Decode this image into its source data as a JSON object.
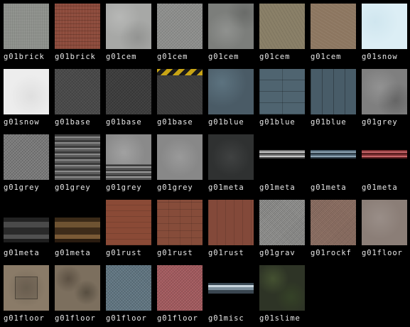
{
  "tiles": [
    {
      "label": "g01brick",
      "texture": "gbrick",
      "color": "#8e918c"
    },
    {
      "label": "g01brick",
      "texture": "rbrick",
      "color": "#8b4a3b"
    },
    {
      "label": "g01cem",
      "texture": "cem1",
      "color": "#a7a8a6"
    },
    {
      "label": "g01cem",
      "texture": "cem2",
      "color": "#8d8e8c"
    },
    {
      "label": "g01cem",
      "texture": "cem3",
      "color": "#7c7e7b"
    },
    {
      "label": "g01cem",
      "texture": "cem4",
      "color": "#8a8068"
    },
    {
      "label": "g01cem",
      "texture": "cem5",
      "color": "#8c7660"
    },
    {
      "label": "g01snow",
      "texture": "snow1",
      "color": "#dceef5"
    },
    {
      "label": "g01snow",
      "texture": "snow2",
      "color": "#ededed"
    },
    {
      "label": "g01base",
      "texture": "base1",
      "color": "#4a4a4a"
    },
    {
      "label": "g01base",
      "texture": "base2",
      "color": "#3e3e3e"
    },
    {
      "label": "g01base",
      "texture": "base3",
      "color": "#3a3a3a",
      "overlay": "hazard"
    },
    {
      "label": "g01blue",
      "texture": "blue1",
      "color": "#4a5b66"
    },
    {
      "label": "g01blue",
      "texture": "blue2",
      "color": "#4f6470"
    },
    {
      "label": "g01blue",
      "texture": "blue3",
      "color": "#485c68"
    },
    {
      "label": "g01grey",
      "texture": "grey1",
      "color": "#7f7f7f"
    },
    {
      "label": "g01grey",
      "texture": "grey2",
      "color": "#7a7a7a"
    },
    {
      "label": "g01grey",
      "texture": "grey3",
      "color": "#5c5c5c"
    },
    {
      "label": "g01grey",
      "texture": "grey4",
      "color": "#8a8a8a",
      "overlay": "grey4-stripes"
    },
    {
      "label": "g01grey",
      "texture": "grey5",
      "color": "#888888"
    },
    {
      "label": "g01meta",
      "texture": "meta1",
      "color": "#2f3131"
    },
    {
      "label": "g01meta",
      "texture": "misc",
      "color": "#000000",
      "overlay": "strip strip-grey"
    },
    {
      "label": "g01meta",
      "texture": "misc",
      "color": "#000000",
      "overlay": "strip strip-blue"
    },
    {
      "label": "g01meta",
      "texture": "misc",
      "color": "#000000",
      "overlay": "strip strip-red"
    },
    {
      "label": "g01meta",
      "texture": "misc",
      "color": "#000000",
      "overlay": "strip strip-dark"
    },
    {
      "label": "g01meta",
      "texture": "misc",
      "color": "#000000",
      "overlay": "strip strip-brown"
    },
    {
      "label": "g01rust",
      "texture": "rust1",
      "color": "#8a4a36"
    },
    {
      "label": "g01rust",
      "texture": "rust2",
      "color": "#864c3a"
    },
    {
      "label": "g01rust",
      "texture": "rust3",
      "color": "#83493a"
    },
    {
      "label": "g01grav",
      "texture": "grav",
      "color": "#8d8d8b"
    },
    {
      "label": "g01rockf",
      "texture": "rockf",
      "color": "#8c6e62"
    },
    {
      "label": "g01floor",
      "texture": "floor1",
      "color": "#8b7e77"
    },
    {
      "label": "g01floor",
      "texture": "floor2",
      "color": "#8a7b68",
      "overlay": "floor-inner"
    },
    {
      "label": "g01floor",
      "texture": "floor3",
      "color": "#7c6f5e"
    },
    {
      "label": "g01floor",
      "texture": "floor4",
      "color": "#5f7480"
    },
    {
      "label": "g01floor",
      "texture": "floor5",
      "color": "#a35a5e"
    },
    {
      "label": "g01misc",
      "texture": "misc",
      "color": "#000000",
      "overlay": "strip strip-misc"
    },
    {
      "label": "g01slime",
      "texture": "slime",
      "color": "#2e3426"
    }
  ]
}
